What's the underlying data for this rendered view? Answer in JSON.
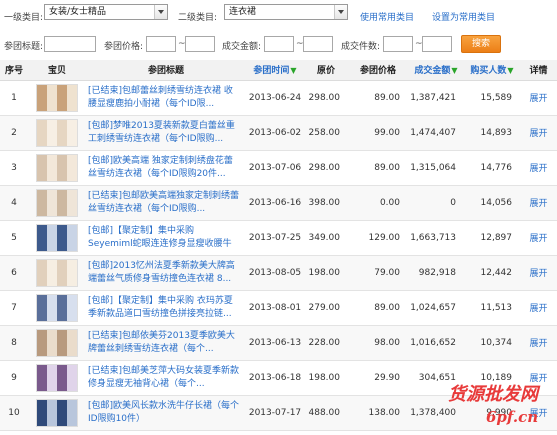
{
  "filters": {
    "cat1_label": "一级类目:",
    "cat1_value": "女装/女士精品",
    "cat2_label": "二级类目:",
    "cat2_value": "连衣裙",
    "use_common": "使用常用类目",
    "set_common": "设置为常用类目",
    "title_label": "参团标题:",
    "price_label": "参团价格:",
    "amount_label": "成交金额:",
    "count_label": "成交件数:",
    "tilde": "~",
    "search": "搜索"
  },
  "table": {
    "headers": [
      "序号",
      "宝贝",
      "参团标题",
      "参团时间",
      "原价",
      "参团价格",
      "成交金额",
      "购买人数",
      "详情"
    ],
    "rows": [
      {
        "no": "1",
        "title": "[已结束]包邮蕾丝刺绣雪纺连衣裙 收腰显瘦鹿拍小耐裙（每个ID限...",
        "date": "2013-06-24",
        "orig": "298.00",
        "price": "89.00",
        "amount": "1,387,421",
        "buyers": "15,589",
        "detail": "展开"
      },
      {
        "no": "2",
        "title": "[包邮]梦唯2013夏装新款夏白蕾丝重工刺绣雪纺连衣裙（每个ID限购...",
        "date": "2013-06-02",
        "orig": "258.00",
        "price": "99.00",
        "amount": "1,474,407",
        "buyers": "14,893",
        "detail": "展开"
      },
      {
        "no": "3",
        "title": "[包邮]欧美高端 独家定制刺绣盘花蕾丝雪纺连衣裙（每个ID限购20件...",
        "date": "2013-07-06",
        "orig": "298.00",
        "price": "89.00",
        "amount": "1,315,064",
        "buyers": "14,776",
        "detail": "展开"
      },
      {
        "no": "4",
        "title": "[已结束]包邮欧美高端独家定制刺绣蕾丝雪纺连衣裙（每个ID限购...",
        "date": "2013-06-16",
        "orig": "398.00",
        "price": "0.00",
        "amount": "0",
        "buyers": "14,056",
        "detail": "展开"
      },
      {
        "no": "5",
        "title": "[包邮]【聚定制】集中采购 Seyemiml蛇眼连连修身显瘦收腰牛仔裙...",
        "date": "2013-07-25",
        "orig": "349.00",
        "price": "129.00",
        "amount": "1,663,713",
        "buyers": "12,897",
        "detail": "展开"
      },
      {
        "no": "6",
        "title": "[包邮]2013忆州法夏季新款美大牌高端蕾丝气质修身雪纺撞色连衣裙 8...",
        "date": "2013-08-05",
        "orig": "198.00",
        "price": "79.00",
        "amount": "982,918",
        "buyers": "12,442",
        "detail": "展开"
      },
      {
        "no": "7",
        "title": "[包邮]【聚定制】集中采购 衣玛苏夏季新款品道口雪纺撞色拼接亮拉链...",
        "date": "2013-08-01",
        "orig": "279.00",
        "price": "89.00",
        "amount": "1,024,657",
        "buyers": "11,513",
        "detail": "展开"
      },
      {
        "no": "8",
        "title": "[已结束]包邮依美芬2013夏季欧美大牌蕾丝刺绣雪纺连衣裙（每个...",
        "date": "2013-06-13",
        "orig": "228.00",
        "price": "98.00",
        "amount": "1,016,652",
        "buyers": "10,374",
        "detail": "展开"
      },
      {
        "no": "9",
        "title": "[已结束]包邮美芝萍大码女装夏季新款修身显瘦无袖背心裙（每个...",
        "date": "2013-06-18",
        "orig": "198.00",
        "price": "29.90",
        "amount": "304,651",
        "buyers": "10,189",
        "detail": "展开"
      },
      {
        "no": "10",
        "title": "[包邮]欧美风长款水洗牛仔长裙（每个ID限购10件）",
        "date": "2013-07-17",
        "orig": "488.00",
        "price": "138.00",
        "amount": "1,378,400",
        "buyers": "9,990",
        "detail": "展开"
      }
    ]
  },
  "watermark": {
    "line1": "货源批发网",
    "line2": "6pf.cn"
  },
  "colors": {
    "link": "#2a6fc9",
    "sort_arrow": "#2aa52a",
    "search_button": "#ec7f17",
    "watermark": "#e83a3a"
  }
}
